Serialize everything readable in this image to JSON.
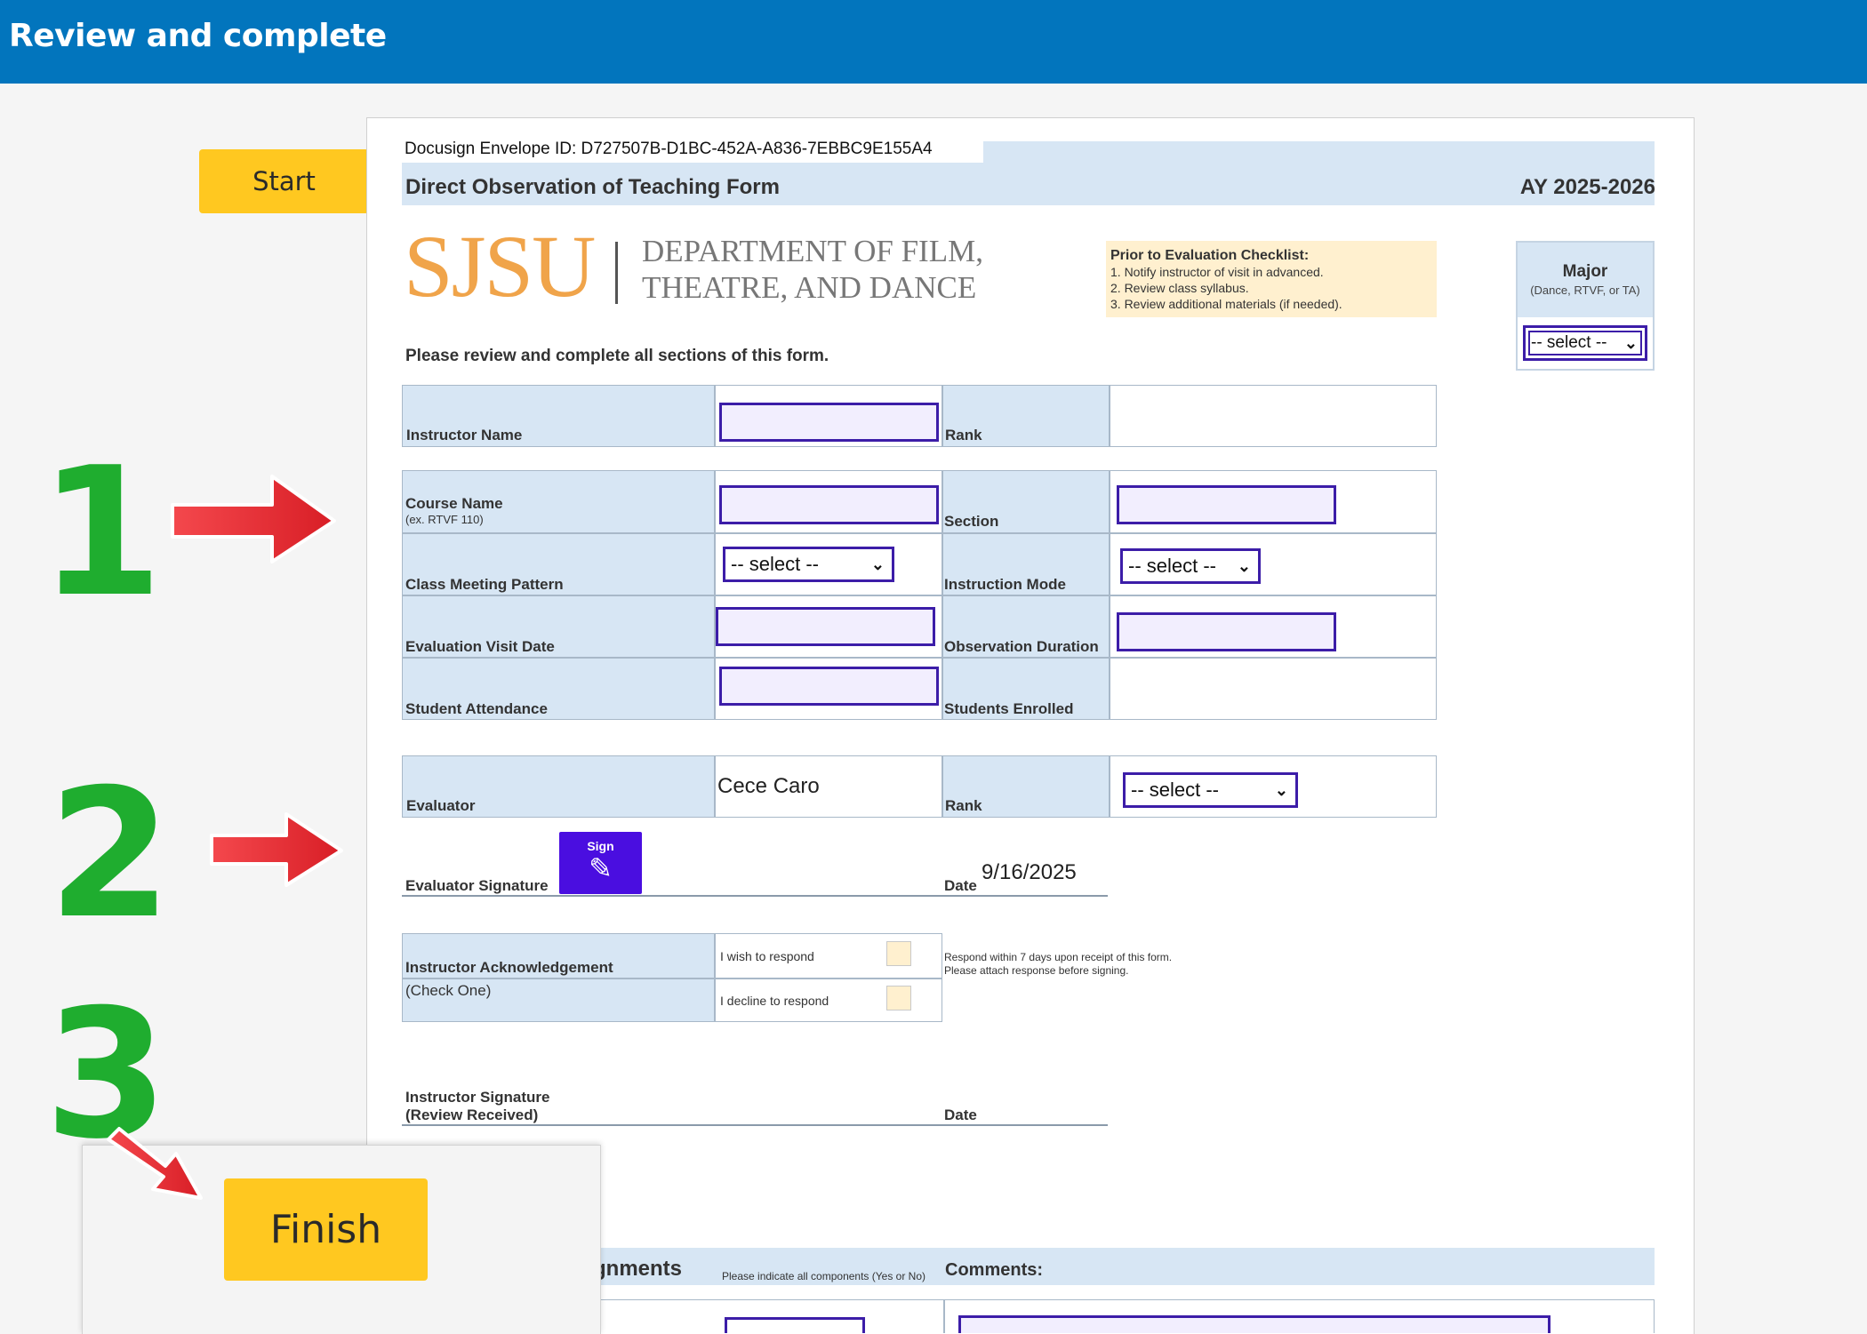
{
  "header": {
    "title": "Review and complete"
  },
  "buttons": {
    "start": "Start",
    "finish": "Finish",
    "sign": "Sign"
  },
  "document": {
    "envelope_id": "Docusign Envelope ID: D727507B-D1BC-452A-A836-7EBBC9E155A4",
    "form_title": "Direct Observation of Teaching Form",
    "academic_year": "AY 2025-2026",
    "logo": {
      "wordmark": "SJSU",
      "dept_line1": "DEPARTMENT OF FILM,",
      "dept_line2": "THEATRE, AND DANCE"
    },
    "checklist": {
      "title": "Prior to Evaluation Checklist:",
      "items": [
        "1. Notify instructor of visit in advanced.",
        "2. Review class syllabus.",
        "3. Review additional materials (if needed)."
      ]
    },
    "major": {
      "title": "Major",
      "subtitle": "(Dance, RTVF, or TA)",
      "select": "-- select --"
    },
    "instruction": "Please review and complete all sections of this form.",
    "labels": {
      "instructor_name": "Instructor Name",
      "rank": "Rank",
      "course_name": "Course Name",
      "course_name_hint": "(ex. RTVF 110)",
      "section": "Section",
      "class_meeting_pattern": "Class Meeting Pattern",
      "instruction_mode": "Instruction Mode",
      "evaluation_visit_date": "Evaluation Visit Date",
      "observation_duration": "Observation Duration",
      "student_attendance": "Student Attendance",
      "students_enrolled": "Students Enrolled",
      "evaluator": "Evaluator",
      "evaluator_signature": "Evaluator Signature",
      "date": "Date",
      "instructor_ack": "Instructor Acknowledgement",
      "check_one": "(Check One)",
      "wish_respond": "I wish to respond",
      "decline_respond": "I decline to respond",
      "respond_note_1": "Respond within 7 days upon receipt of this form.",
      "respond_note_2": "Please attach response before signing.",
      "instructor_signature": "Instructor Signature",
      "review_received": "(Review Received)",
      "assignments_partial": "gnments",
      "assignments_hint": "Please indicate all components (Yes or No)",
      "comments": "Comments:"
    },
    "values": {
      "evaluator": "Cece Caro",
      "evaluator_date": "9/16/2025",
      "select_placeholder": "-- select --"
    }
  },
  "annotations": {
    "step1": "1",
    "step2": "2",
    "step3": "3"
  },
  "colors": {
    "topbar": "#0275bd",
    "accent_yellow": "#ffc820",
    "field_border": "#3c1da8",
    "label_bg": "#d7e6f4",
    "step_green": "#1fad2f",
    "arrow_red": "#e8333a",
    "sign_purple": "#4a0ee0"
  }
}
